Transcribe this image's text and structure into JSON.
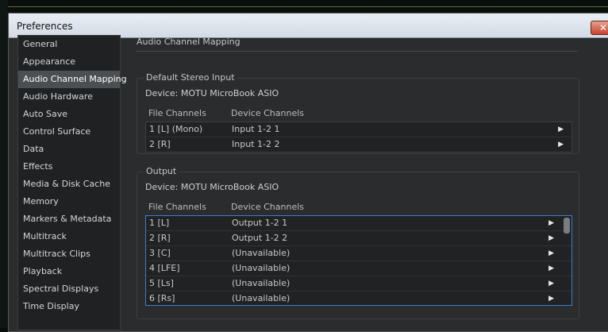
{
  "window": {
    "title": "Preferences",
    "close_glyph": "✕"
  },
  "sidebar": {
    "items": [
      {
        "label": "General"
      },
      {
        "label": "Appearance"
      },
      {
        "label": "Audio Channel Mapping",
        "selected": true
      },
      {
        "label": "Audio Hardware"
      },
      {
        "label": "Auto Save"
      },
      {
        "label": "Control Surface"
      },
      {
        "label": "Data"
      },
      {
        "label": "Effects"
      },
      {
        "label": "Media & Disk Cache"
      },
      {
        "label": "Memory"
      },
      {
        "label": "Markers & Metadata"
      },
      {
        "label": "Multitrack"
      },
      {
        "label": "Multitrack Clips"
      },
      {
        "label": "Playback"
      },
      {
        "label": "Spectral Displays"
      },
      {
        "label": "Time Display"
      }
    ]
  },
  "main": {
    "heading": "Audio Channel Mapping",
    "stereo_input": {
      "group_label": "Default Stereo Input",
      "device": "Device: MOTU MicroBook ASIO",
      "col_file": "File Channels",
      "col_device": "Device Channels",
      "rows": [
        {
          "file": "1 [L] (Mono)",
          "device": "Input 1-2 1"
        },
        {
          "file": "2 [R]",
          "device": "Input 1-2 2"
        }
      ]
    },
    "output": {
      "group_label": "Output",
      "device": "Device: MOTU MicroBook ASIO",
      "col_file": "File Channels",
      "col_device": "Device Channels",
      "rows": [
        {
          "file": "1 [L]",
          "device": "Output 1-2 1"
        },
        {
          "file": "2 [R]",
          "device": "Output 1-2 2"
        },
        {
          "file": "3 [C]",
          "device": "(Unavailable)"
        },
        {
          "file": "4 [LFE]",
          "device": "(Unavailable)"
        },
        {
          "file": "5 [Ls]",
          "device": "(Unavailable)"
        },
        {
          "file": "6 [Rs]",
          "device": "(Unavailable)"
        }
      ]
    }
  },
  "icons": {
    "row_expand": "arrow-right-icon",
    "expand_glyph": "▶"
  }
}
